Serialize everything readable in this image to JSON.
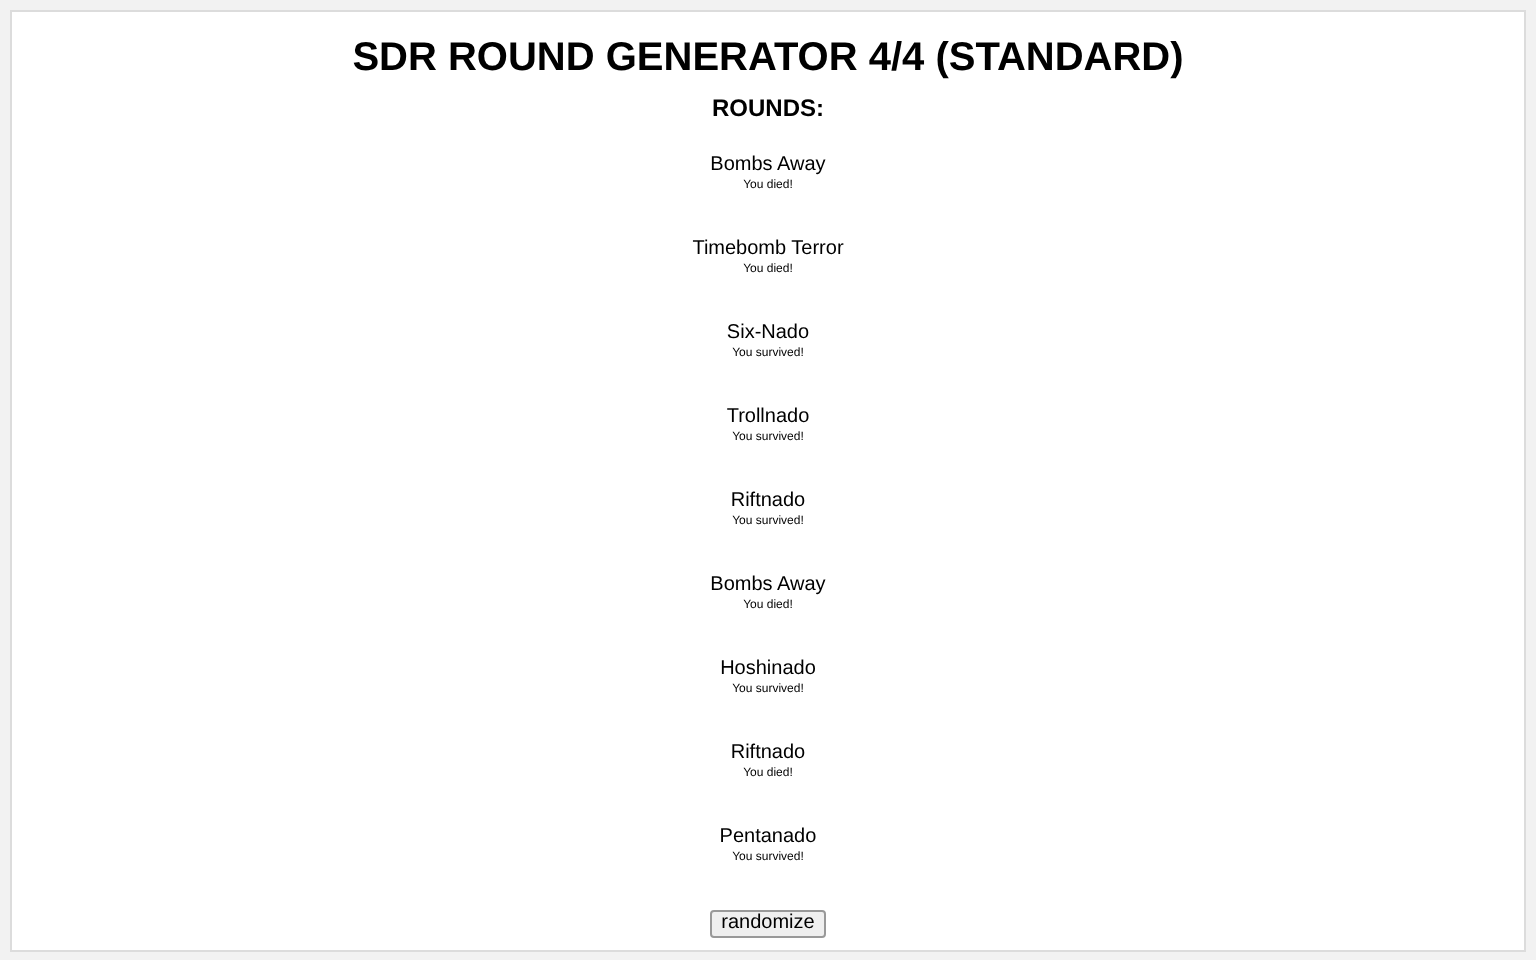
{
  "title": "SDR ROUND GENERATOR 4/4 (STANDARD)",
  "rounds_heading": "ROUNDS:",
  "rounds": [
    {
      "name": "Bombs Away",
      "result": "You died!"
    },
    {
      "name": "Timebomb Terror",
      "result": "You died!"
    },
    {
      "name": "Six-Nado",
      "result": "You survived!"
    },
    {
      "name": "Trollnado",
      "result": "You survived!"
    },
    {
      "name": "Riftnado",
      "result": "You survived!"
    },
    {
      "name": "Bombs Away",
      "result": "You died!"
    },
    {
      "name": "Hoshinado",
      "result": "You survived!"
    },
    {
      "name": "Riftnado",
      "result": "You died!"
    },
    {
      "name": "Pentanado",
      "result": "You survived!"
    }
  ],
  "button": "randomize"
}
